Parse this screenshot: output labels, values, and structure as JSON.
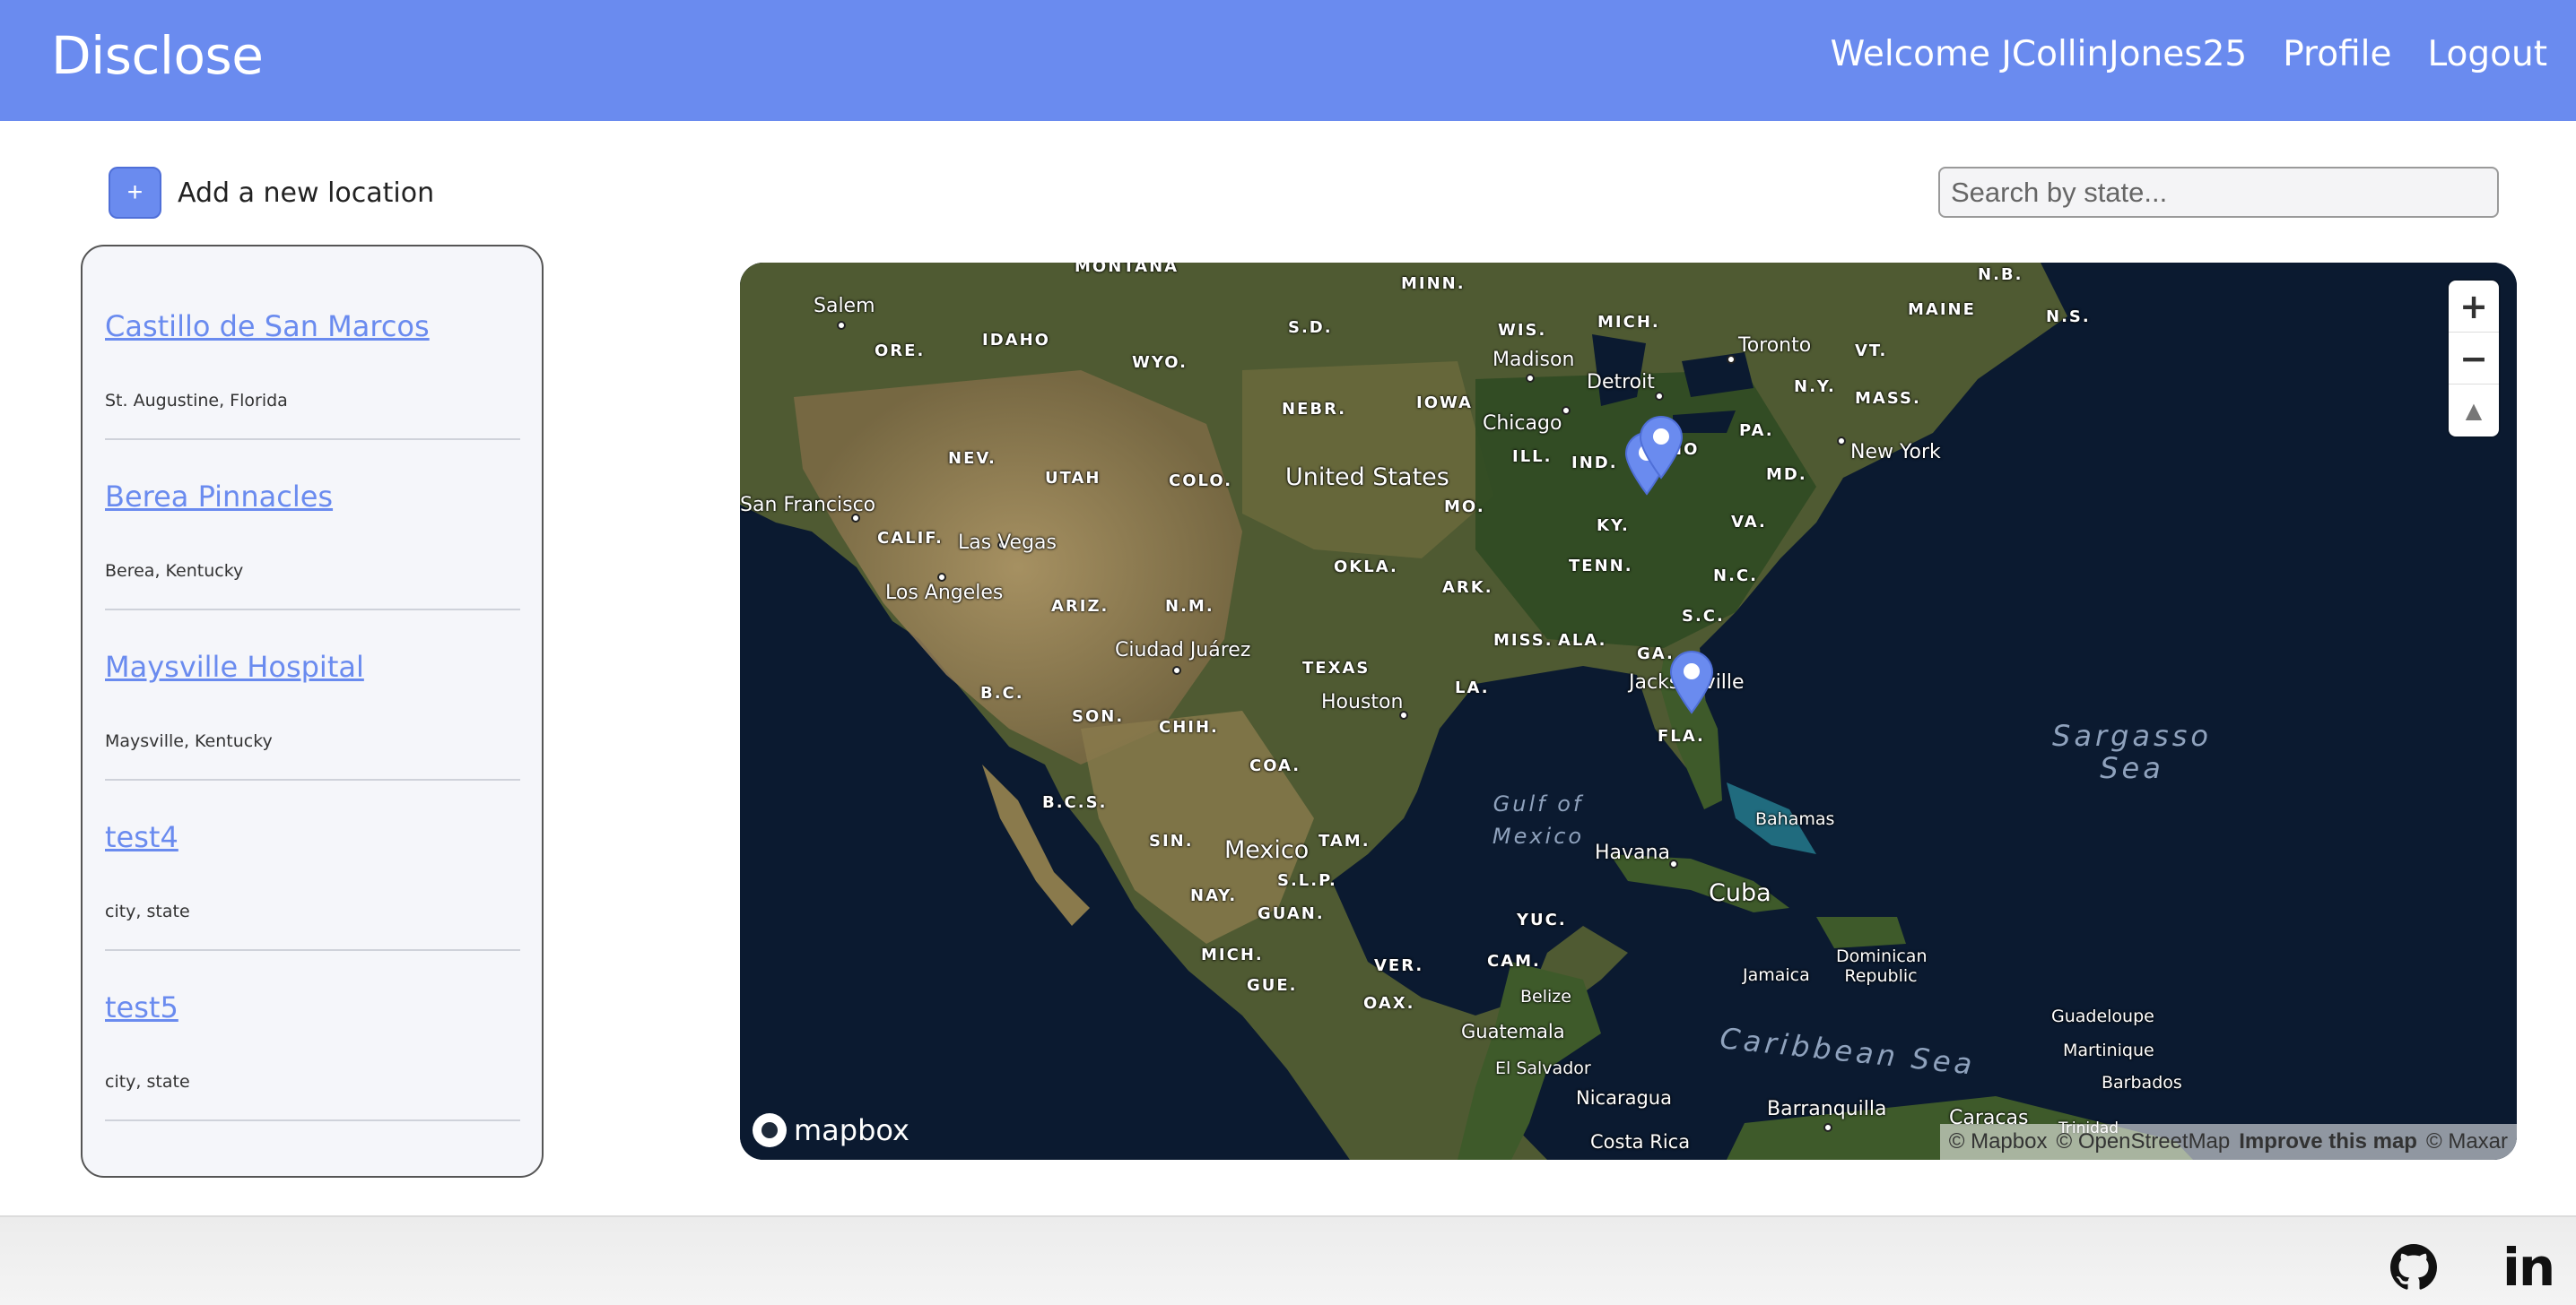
{
  "header": {
    "brand": "Disclose",
    "welcome": "Welcome JCollinJones25",
    "profile": "Profile",
    "logout": "Logout",
    "color": "#6a8bef"
  },
  "actions": {
    "add_symbol": "+",
    "add_label": "Add a new location"
  },
  "search": {
    "placeholder": "Search by state...",
    "value": ""
  },
  "locations": [
    {
      "name": "Castillo de San Marcos",
      "place": "St. Augustine, Florida"
    },
    {
      "name": "Berea Pinnacles",
      "place": "Berea, Kentucky"
    },
    {
      "name": "Maysville Hospital",
      "place": "Maysville, Kentucky"
    },
    {
      "name": "test4",
      "place": "city, state"
    },
    {
      "name": "test5",
      "place": "city, state"
    }
  ],
  "map": {
    "style": "satellite",
    "states": [
      "MONTANA",
      "MINN.",
      "WIS.",
      "MICH.",
      "MAINE",
      "N.B.",
      "N.S.",
      "ORE.",
      "IDAHO",
      "WYO.",
      "S.D.",
      "NEBR.",
      "IOWA",
      "ILL.",
      "IND.",
      "OHIO",
      "PA.",
      "N.Y.",
      "VT.",
      "MASS.",
      "NEV.",
      "UTAH",
      "COLO.",
      "MO.",
      "KY.",
      "VA.",
      "MD.",
      "CALIF.",
      "ARIZ.",
      "N.M.",
      "OKLA.",
      "ARK.",
      "TENN.",
      "N.C.",
      "S.C.",
      "TEXAS",
      "LA.",
      "MISS.",
      "ALA.",
      "GA.",
      "FLA.",
      "B.C.",
      "SON.",
      "CHIH.",
      "COA.",
      "B.C.S.",
      "SIN.",
      "TAM.",
      "NAY.",
      "S.L.P.",
      "GUAN.",
      "MICH.",
      "GUE.",
      "OAX.",
      "VER.",
      "YUC.",
      "CAM."
    ],
    "cities": [
      "Salem",
      "Madison",
      "Toronto",
      "Detroit",
      "Chicago",
      "New York",
      "San Francisco",
      "Las Vegas",
      "Los Angeles",
      "Ciudad Juárez",
      "Houston",
      "Jacksonville",
      "Havana",
      "Bahamas",
      "Jamaica",
      "Dominican Republic",
      "Guadeloupe",
      "Martinique",
      "Barbados",
      "Belize",
      "Guatemala",
      "El Salvador",
      "Nicaragua",
      "Costa Rica",
      "Barranquilla",
      "Caracas",
      "Trinidad"
    ],
    "countries": [
      "United States",
      "Mexico",
      "Cuba"
    ],
    "water": [
      "Gulf of Mexico",
      "Sargasso Sea",
      "Caribbean Sea"
    ],
    "markers": [
      "Berea Pinnacles",
      "Maysville Hospital",
      "Castillo de San Marcos"
    ],
    "zoom_in": "+",
    "zoom_out": "−",
    "compass": "▲",
    "logo_text": "mapbox",
    "attribution": {
      "mapbox": "© Mapbox",
      "osm": "© OpenStreetMap",
      "improve": "Improve this map",
      "maxar": "© Maxar"
    }
  },
  "footer": {
    "github_icon": "github-icon",
    "linkedin_text": "in"
  }
}
